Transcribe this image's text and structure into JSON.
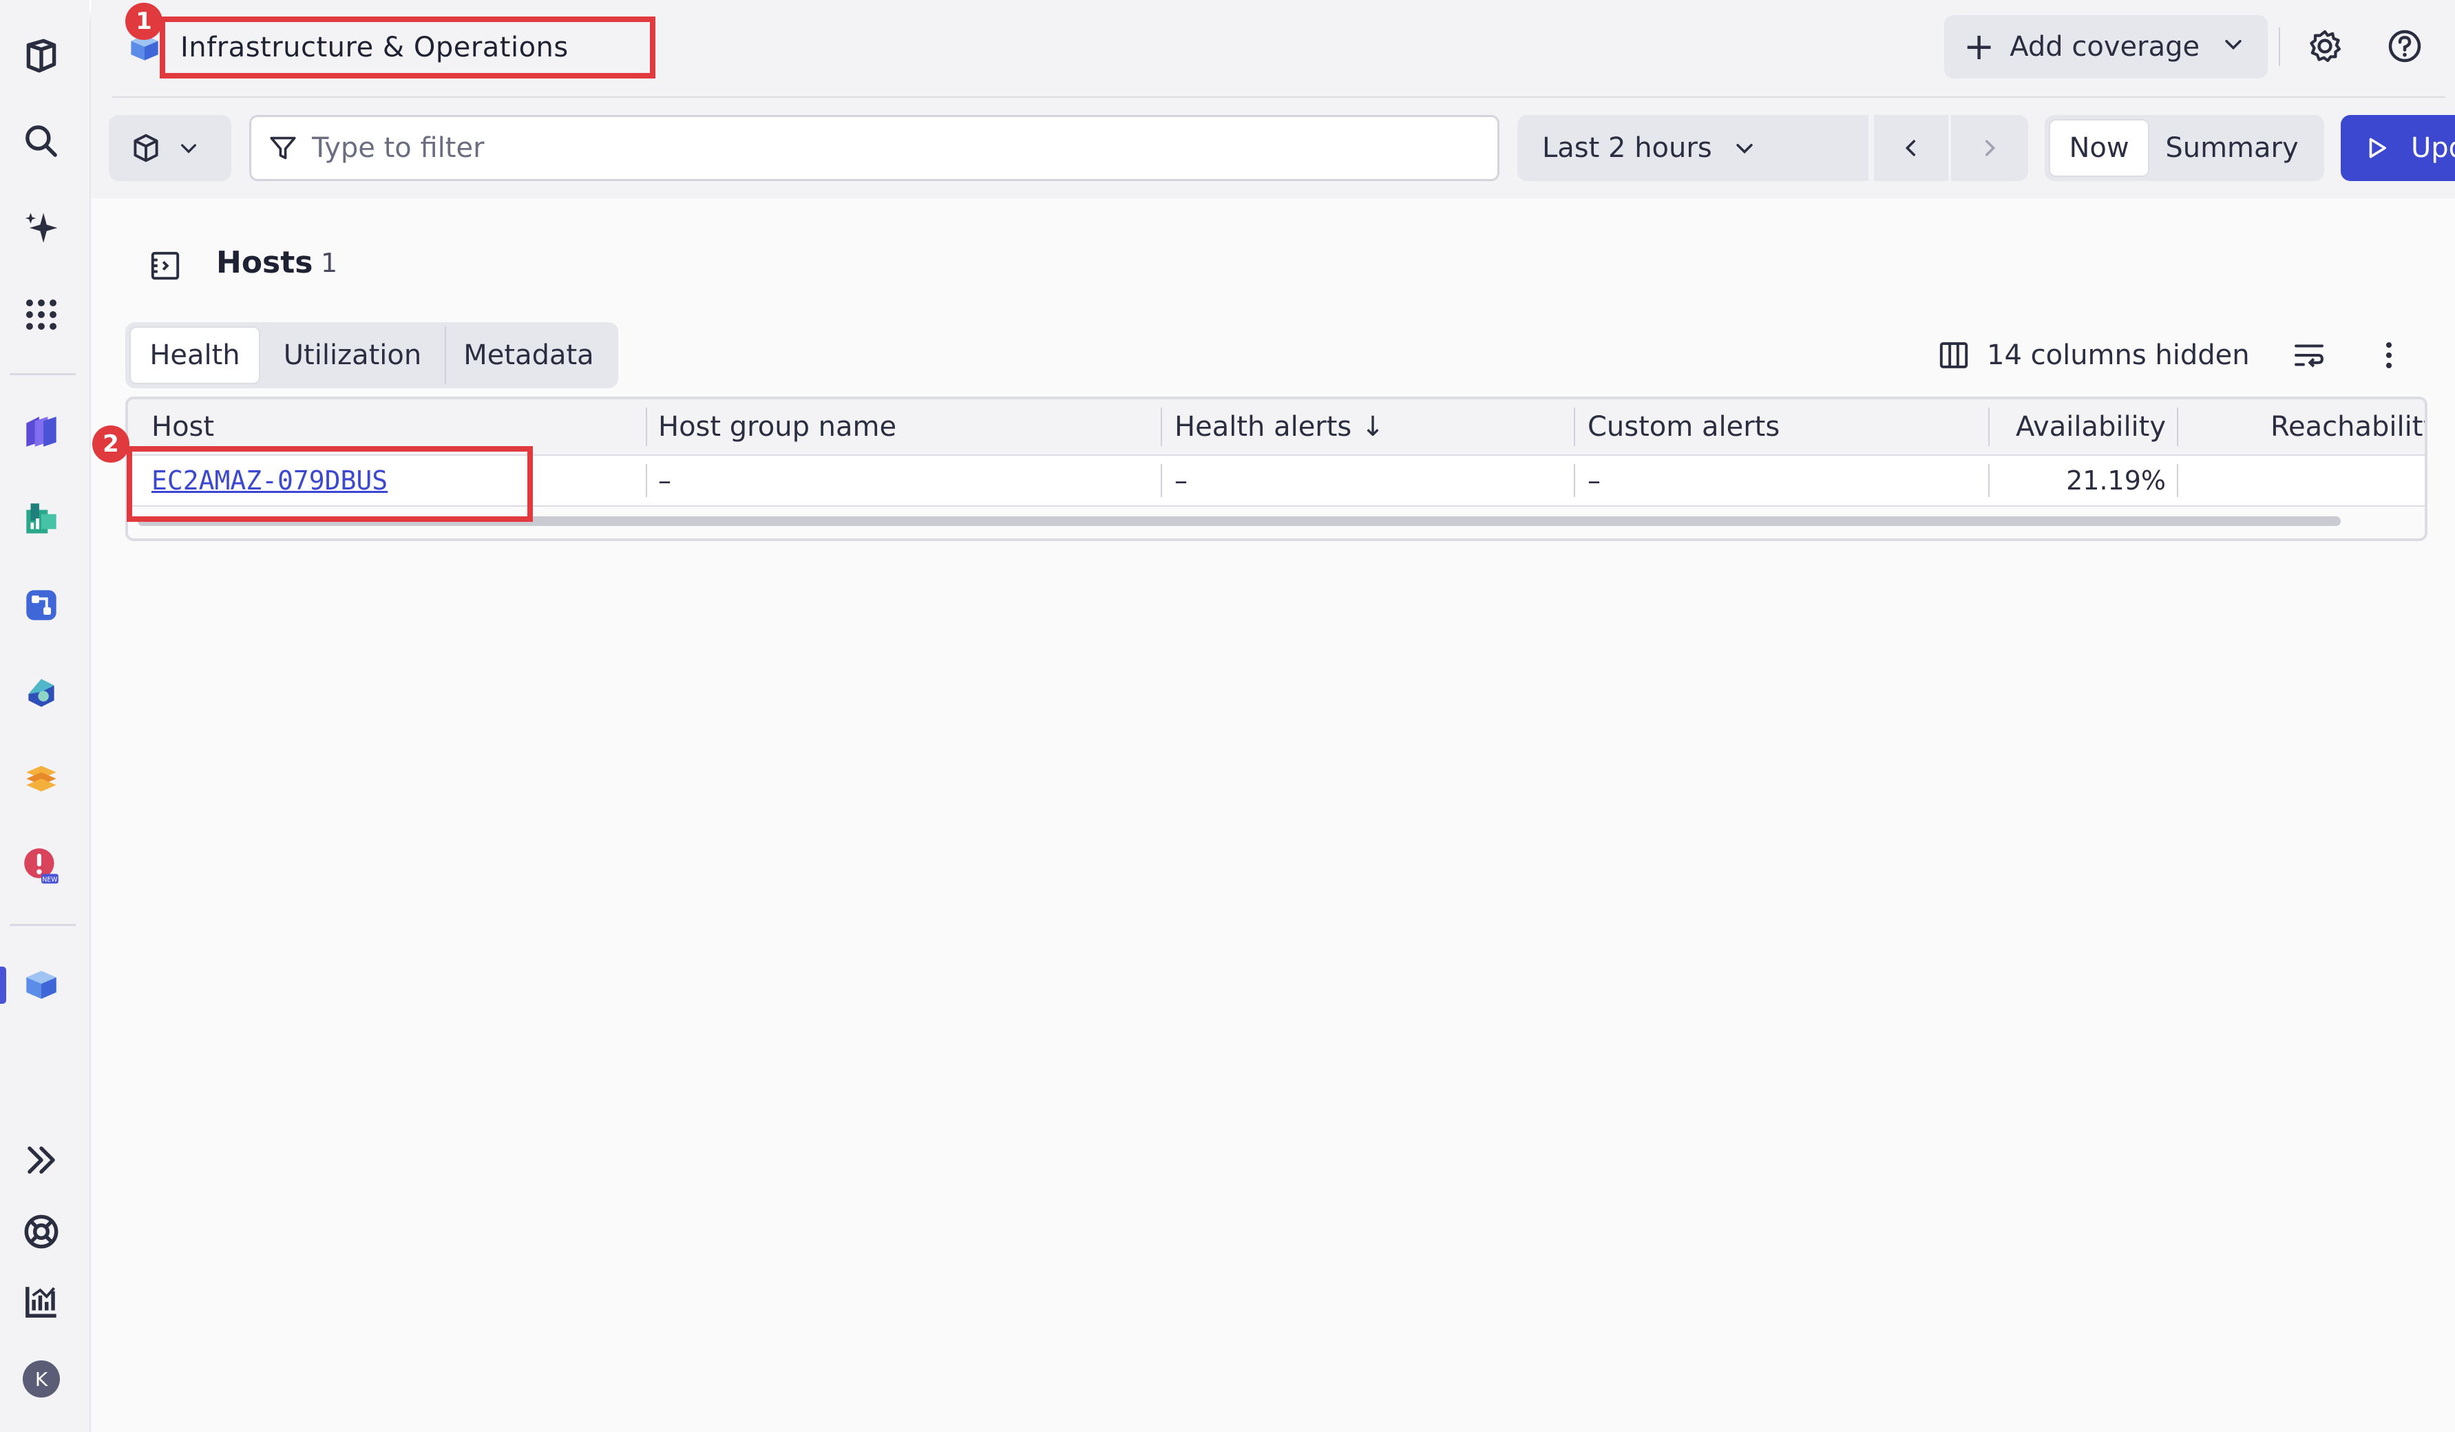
{
  "header": {
    "app_title": "Infrastructure & Operations",
    "add_coverage_label": "Add coverage",
    "annotation_1": "1",
    "annotation_2": "2"
  },
  "toolbar": {
    "filter_placeholder": "Type to filter",
    "timeframe_label": "Last 2 hours",
    "now_label": "Now",
    "summary_label": "Summary",
    "update_label": "Update"
  },
  "section": {
    "title": "Hosts",
    "count": "1"
  },
  "tabs": [
    {
      "label": "Health"
    },
    {
      "label": "Utilization"
    },
    {
      "label": "Metadata"
    }
  ],
  "table_tools": {
    "columns_hidden_label": "14 columns hidden"
  },
  "table": {
    "columns": [
      "Host",
      "Host group name",
      "Health alerts",
      "Custom alerts",
      "Availability",
      "Reachability"
    ],
    "sort_indicator": "↓",
    "rows": [
      {
        "host": "EC2AMAZ-079DBUS",
        "host_group_name": "–",
        "health_alerts": "–",
        "custom_alerts": "–",
        "availability": "21.19%",
        "reachability": ""
      }
    ]
  },
  "rail": {
    "avatar_initial": "K"
  },
  "colors": {
    "accent": "#3c48cf",
    "annotation": "#e0393e",
    "rail_bg": "#f3f3f6",
    "surface": "#fafafb"
  }
}
